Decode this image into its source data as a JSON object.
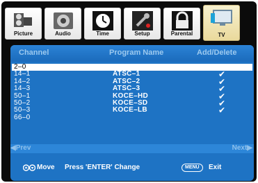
{
  "tabs": [
    {
      "label": "Picture",
      "icon": "film-camera-icon"
    },
    {
      "label": "Audio",
      "icon": "speaker-icon"
    },
    {
      "label": "Time",
      "icon": "clock-icon"
    },
    {
      "label": "Setup",
      "icon": "wrench-icon"
    },
    {
      "label": "Parental",
      "icon": "lock-icon"
    },
    {
      "label": "TV",
      "icon": "tv-monitor-icon",
      "active": true
    }
  ],
  "table": {
    "headers": {
      "channel": "Channel",
      "program": "Program Name",
      "add_delete": "Add/Delete"
    },
    "rows": [
      {
        "channel": "2–0",
        "program": "",
        "checked": false,
        "selected": true
      },
      {
        "channel": "14–1",
        "program": "ATSC–1",
        "checked": true
      },
      {
        "channel": "14–2",
        "program": "ATSC–2",
        "checked": true
      },
      {
        "channel": "14–3",
        "program": "ATSC–3",
        "checked": true
      },
      {
        "channel": "50–1",
        "program": "KOCE–HD",
        "checked": true
      },
      {
        "channel": "50–2",
        "program": "KOCE–SD",
        "checked": true
      },
      {
        "channel": "50–3",
        "program": "KOCE–LB",
        "checked": true
      },
      {
        "channel": "66–0",
        "program": "",
        "checked": false
      }
    ],
    "check_glyph": "✔"
  },
  "nav": {
    "prev": "◀Prev",
    "next": "Next▶"
  },
  "footer": {
    "move_icon": "up-down-arrows-icon",
    "move_label": "Move",
    "change_label": "Press 'ENTER' Change",
    "menu_key": "MENU",
    "exit_label": "Exit"
  },
  "colors": {
    "panel": "#1e73c4",
    "active_tab": "#ead99c",
    "background": "#0b0b0b"
  }
}
